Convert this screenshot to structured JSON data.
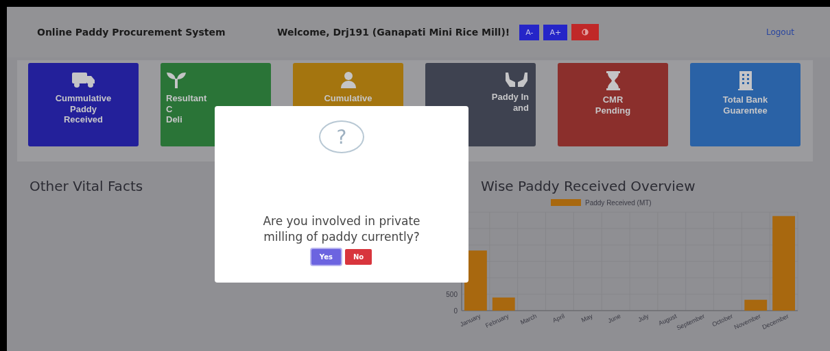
{
  "header": {
    "title": "Online Paddy Procurement System",
    "welcome": "Welcome, Drj191 (Ganapati Mini Rice Mill)!",
    "font_buttons": [
      "A-",
      "A+"
    ],
    "logout": "Logout"
  },
  "tiles": [
    {
      "kind": "truck",
      "lines": [
        "Cummulative",
        "Paddy",
        "Received"
      ],
      "color": "#23209a"
    },
    {
      "kind": "sprout",
      "lines": [
        "Resultant",
        "C",
        "Deli"
      ],
      "color": "#2a7437"
    },
    {
      "kind": "person",
      "lines": [
        "Cumulative"
      ],
      "color": "#a4750f"
    },
    {
      "kind": "hands",
      "lines": [
        "Paddy In",
        "and"
      ],
      "color": "#3e4250"
    },
    {
      "kind": "hourglass",
      "lines": [
        "CMR",
        "Pending"
      ],
      "color": "#8b2f2c"
    },
    {
      "kind": "building",
      "lines": [
        "Total Bank",
        "Guarentee"
      ],
      "color": "#2a62a6"
    }
  ],
  "vital_facts": {
    "title": "Other Vital Facts"
  },
  "overview": {
    "title": "Wise Paddy Received Overview",
    "chart_data": {
      "type": "bar",
      "categories": [
        "January",
        "February",
        "March",
        "April",
        "May",
        "June",
        "July",
        "August",
        "September",
        "October",
        "November",
        "December"
      ],
      "series": [
        {
          "name": "Paddy Received (MT)",
          "color": "#a8680f",
          "values": [
            1830,
            400,
            0,
            0,
            0,
            0,
            0,
            0,
            0,
            0,
            330,
            2880
          ]
        }
      ],
      "ylim": [
        0,
        3000
      ],
      "yticks": [
        0,
        500
      ]
    }
  },
  "dialog": {
    "icon": "?",
    "message": "Are you involved in private milling of paddy currently?",
    "buttons": [
      {
        "label": "Yes",
        "kind": "confirm"
      },
      {
        "label": "No",
        "kind": "cancel"
      }
    ]
  }
}
